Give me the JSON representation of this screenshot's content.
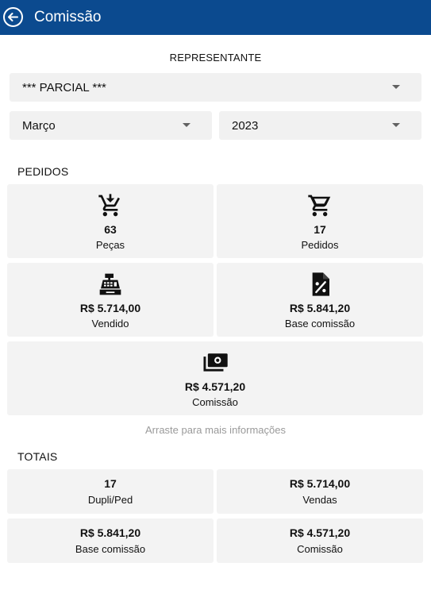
{
  "appbar": {
    "title": "Comissão",
    "color": "#0b4a8f"
  },
  "filters": {
    "representante_label": "REPRESENTANTE",
    "representante_value": "*** PARCIAL ***",
    "month_value": "Março",
    "year_value": "2023"
  },
  "pedidos": {
    "section_label": "PEDIDOS",
    "cards": [
      {
        "icon": "cart-download-icon",
        "value": "63",
        "label": "Peças"
      },
      {
        "icon": "cart-icon",
        "value": "17",
        "label": "Pedidos"
      },
      {
        "icon": "cash-register-icon",
        "value": "R$ 5.714,00",
        "label": "Vendido"
      },
      {
        "icon": "percent-file-icon",
        "value": "R$ 5.841,20",
        "label": "Base comissão"
      },
      {
        "icon": "money-stack-icon",
        "value": "R$ 4.571,20",
        "label": "Comissão"
      }
    ]
  },
  "hint": "Arraste para mais informações",
  "totais": {
    "section_label": "TOTAIS",
    "cards": [
      {
        "value": "17",
        "label": "Dupli/Ped"
      },
      {
        "value": "R$ 5.714,00",
        "label": "Vendas"
      },
      {
        "value": "R$ 5.841,20",
        "label": "Base comissão"
      },
      {
        "value": "R$ 4.571,20",
        "label": "Comissão"
      }
    ]
  }
}
